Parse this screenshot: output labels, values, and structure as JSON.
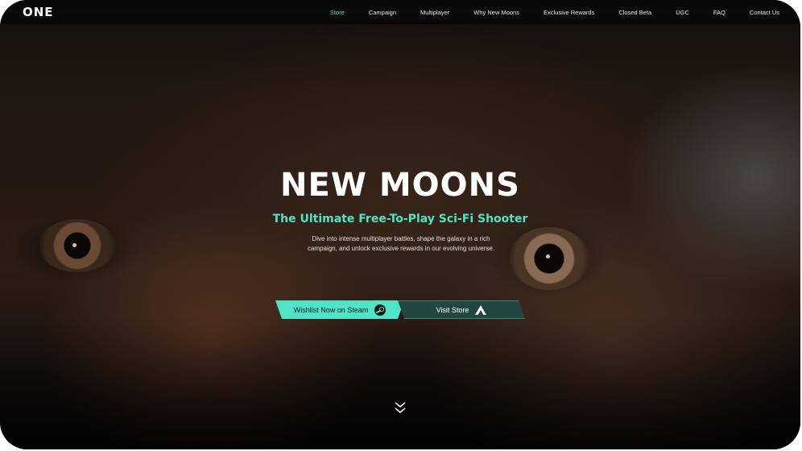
{
  "nav": {
    "logo": "ONE",
    "links": [
      {
        "label": "Store",
        "active": true
      },
      {
        "label": "Campaign"
      },
      {
        "label": "Multiplayer"
      },
      {
        "label": "Why New Moons"
      },
      {
        "label": "Exclusive Rewards"
      },
      {
        "label": "Closed Beta"
      },
      {
        "label": "UGC"
      },
      {
        "label": "FAQ"
      },
      {
        "label": "Contact Us"
      }
    ]
  },
  "hero": {
    "title": "NEW MOONS",
    "subtitle": "The Ultimate Free-To-Play Sci-Fi Shooter",
    "description": "Dive into intense multiplayer battles, shape the galaxy in a rich campaign, and unlock exclusive rewards in our evolving universe.",
    "primary_button": {
      "label": "Wishlist Now on Steam",
      "icon": "steam-icon"
    },
    "secondary_button": {
      "label": "Visit Store",
      "icon": "store-icon"
    },
    "scroll_icon": "chevron-double-down-icon"
  },
  "colors": {
    "accent": "#4fe3c7",
    "nav_background": "#080808",
    "secondary_button": "#23463f"
  }
}
